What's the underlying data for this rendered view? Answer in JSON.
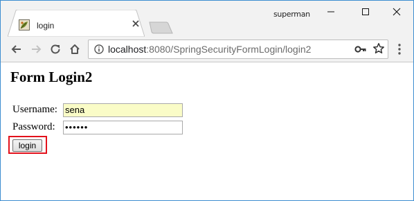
{
  "browser": {
    "tab_title": "login",
    "profile_name": "superman",
    "url_host": "localhost",
    "url_rest": ":8080/SpringSecurityFormLogin/login2"
  },
  "icons": {
    "favicon": "leaf-favicon-icon",
    "tab_close": "close-icon",
    "back": "back-arrow-icon",
    "forward": "forward-arrow-icon",
    "reload": "reload-icon",
    "home": "home-icon",
    "site_info": "info-icon",
    "key": "key-icon",
    "bookmark": "star-icon",
    "menu": "kebab-menu-icon",
    "minimize": "minimize-icon",
    "maximize": "maximize-icon",
    "close_window": "close-icon"
  },
  "page": {
    "heading": "Form Login2",
    "username_label": "Username:",
    "username_value": "sena",
    "password_label": "Password:",
    "password_value": "••••••",
    "login_button": "login"
  },
  "colors": {
    "highlight": "#e3111b",
    "autofill": "#fafcc7",
    "window_border": "#3c8dd0"
  }
}
